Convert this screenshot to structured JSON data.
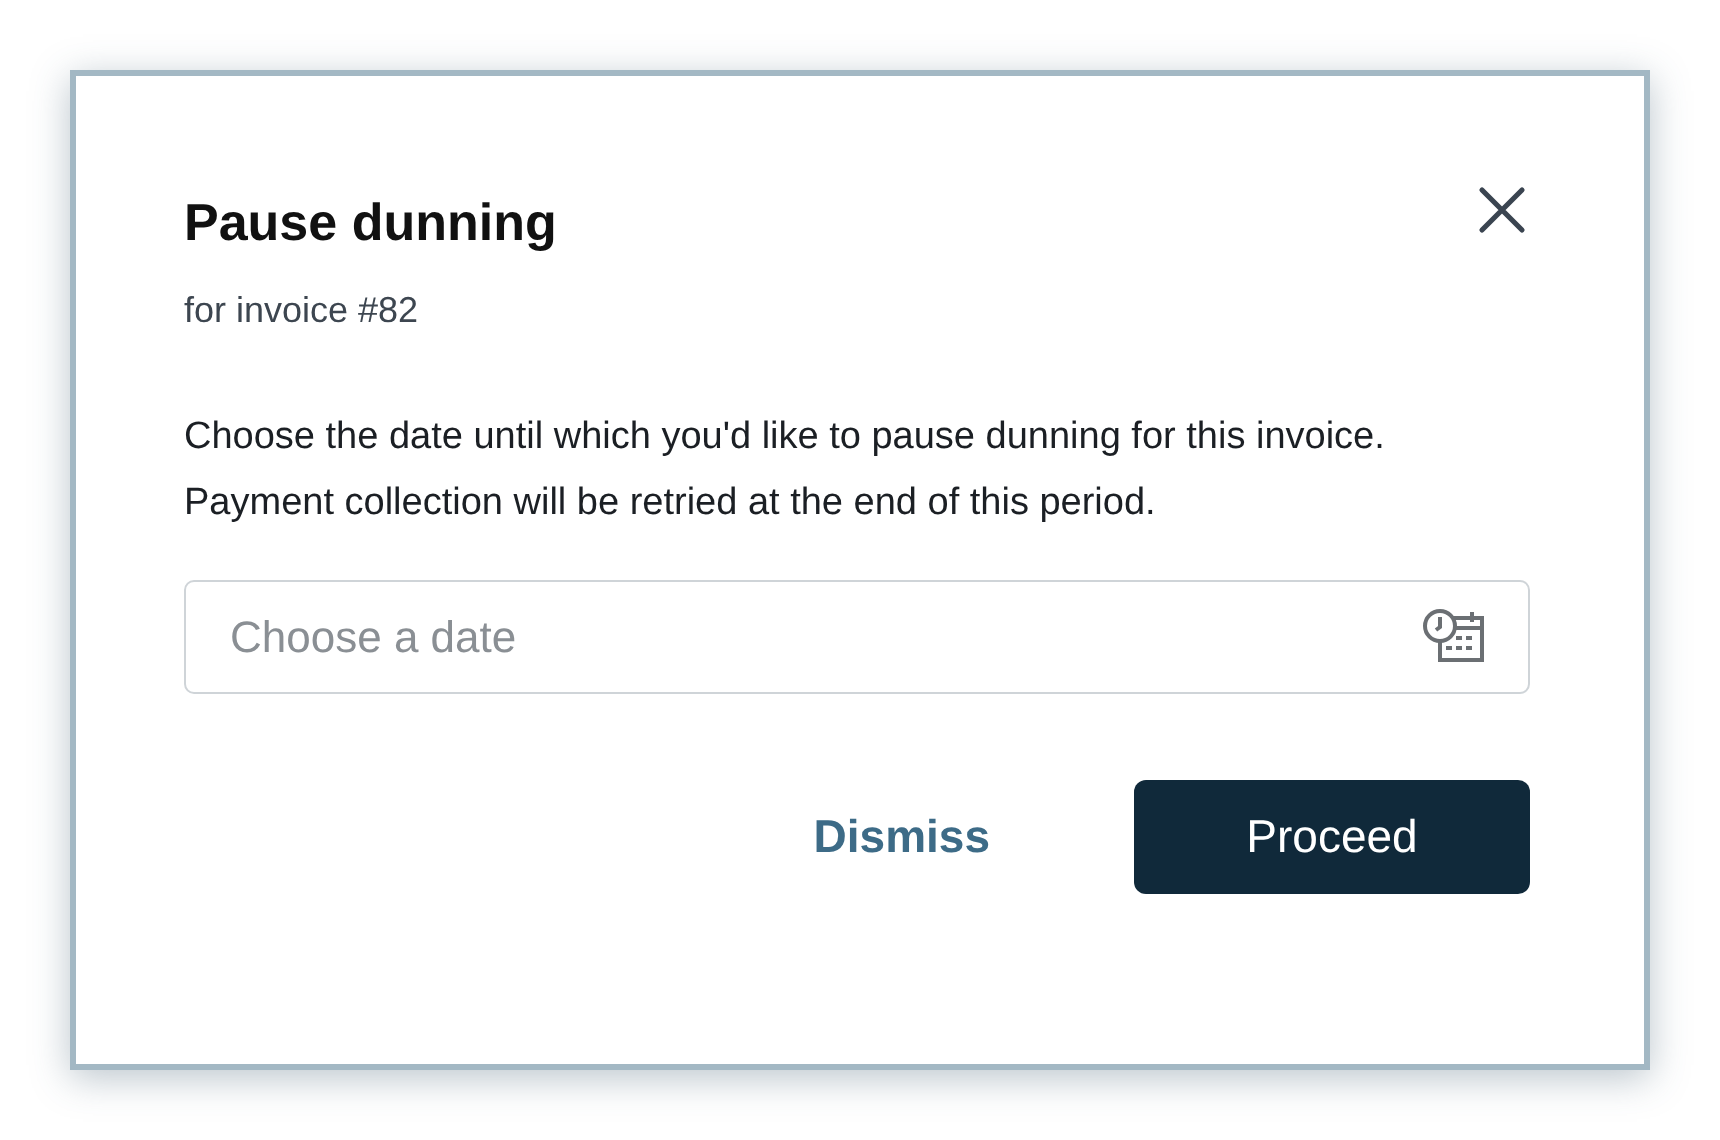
{
  "dialog": {
    "title": "Pause dunning",
    "subtitle": "for invoice #82",
    "description": "Choose the date until which you'd like to pause dunning for this invoice. Payment collection will be retried at the end of this period.",
    "date_field": {
      "placeholder": "Choose a date"
    },
    "buttons": [
      {
        "label": "Dismiss",
        "kind": "secondary"
      },
      {
        "label": "Proceed",
        "kind": "primary"
      }
    ]
  }
}
